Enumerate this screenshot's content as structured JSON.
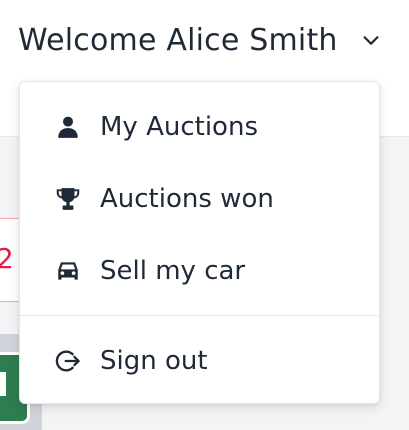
{
  "header": {
    "welcome_text": "Welcome Alice Smith",
    "chevron_icon": "chevron-down-icon"
  },
  "menu": {
    "items": [
      {
        "label": "My Auctions",
        "icon": "user-icon"
      },
      {
        "label": "Auctions won",
        "icon": "trophy-icon"
      },
      {
        "label": "Sell my car",
        "icon": "car-icon"
      },
      {
        "label": "Sign out",
        "icon": "sign-out-icon"
      }
    ]
  },
  "colors": {
    "text": "#1f2937",
    "icon": "#1f2937",
    "border": "#e5e7eb",
    "background": "#ffffff"
  }
}
